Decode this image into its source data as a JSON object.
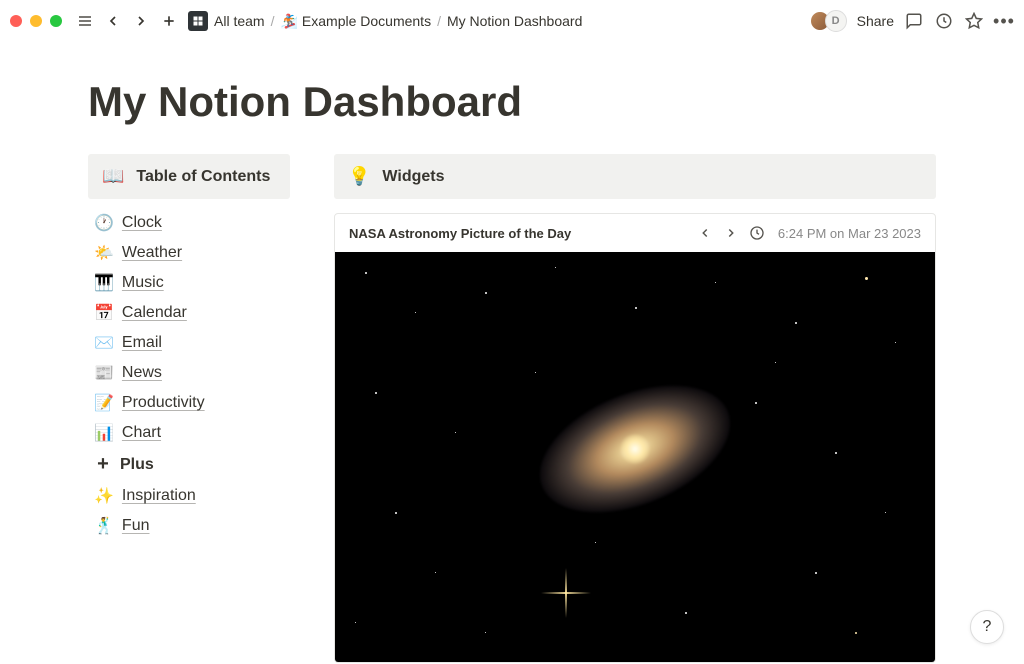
{
  "breadcrumb": {
    "workspace": "All team",
    "folder_icon": "🏂",
    "folder": "Example Documents",
    "page": "My Notion Dashboard"
  },
  "topbar": {
    "share_label": "Share",
    "avatar_letter": "D"
  },
  "page": {
    "title": "My Notion Dashboard"
  },
  "toc": {
    "header_icon": "📖",
    "header_title": "Table of Contents",
    "items": [
      {
        "icon": "🕐",
        "label": "Clock"
      },
      {
        "icon": "🌤️",
        "label": "Weather"
      },
      {
        "icon": "🎹",
        "label": "Music"
      },
      {
        "icon": "📅",
        "label": "Calendar"
      },
      {
        "icon": "✉️",
        "label": "Email"
      },
      {
        "icon": "📰",
        "label": "News"
      },
      {
        "icon": "📝",
        "label": "Productivity"
      },
      {
        "icon": "📊",
        "label": "Chart"
      },
      {
        "icon": "+",
        "label": "Plus",
        "plus": true
      },
      {
        "icon": "✨",
        "label": "Inspiration"
      },
      {
        "icon": "🕺",
        "label": "Fun"
      }
    ]
  },
  "widgets": {
    "header_icon": "💡",
    "header_title": "Widgets",
    "card": {
      "title": "NASA Astronomy Picture of the Day",
      "timestamp": "6:24 PM on Mar 23 2023"
    }
  },
  "help_label": "?"
}
